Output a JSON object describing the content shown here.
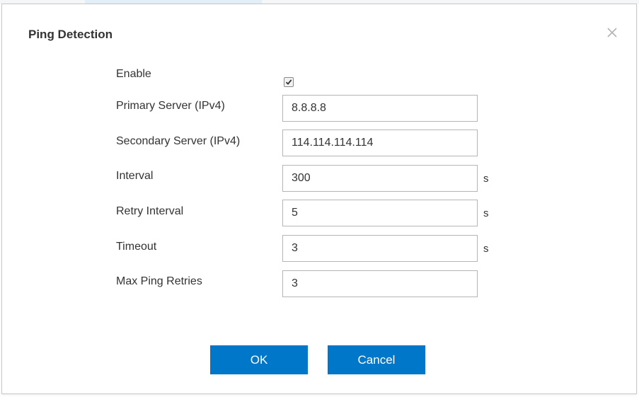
{
  "dialog": {
    "title": "Ping Detection",
    "close_icon": "close-icon"
  },
  "form": {
    "enable": {
      "label": "Enable",
      "checked": true
    },
    "primary_server": {
      "label": "Primary Server (IPv4)",
      "value": "8.8.8.8"
    },
    "secondary_server": {
      "label": "Secondary Server (IPv4)",
      "value": "114.114.114.114"
    },
    "interval": {
      "label": "Interval",
      "value": "300",
      "unit": "s"
    },
    "retry_interval": {
      "label": "Retry Interval",
      "value": "5",
      "unit": "s"
    },
    "timeout": {
      "label": "Timeout",
      "value": "3",
      "unit": "s"
    },
    "max_ping_retries": {
      "label": "Max Ping Retries",
      "value": "3"
    }
  },
  "buttons": {
    "ok_label": "OK",
    "cancel_label": "Cancel"
  },
  "colors": {
    "primary_button": "#0077c8",
    "text": "#333333",
    "input_border": "#b5b5b5"
  }
}
